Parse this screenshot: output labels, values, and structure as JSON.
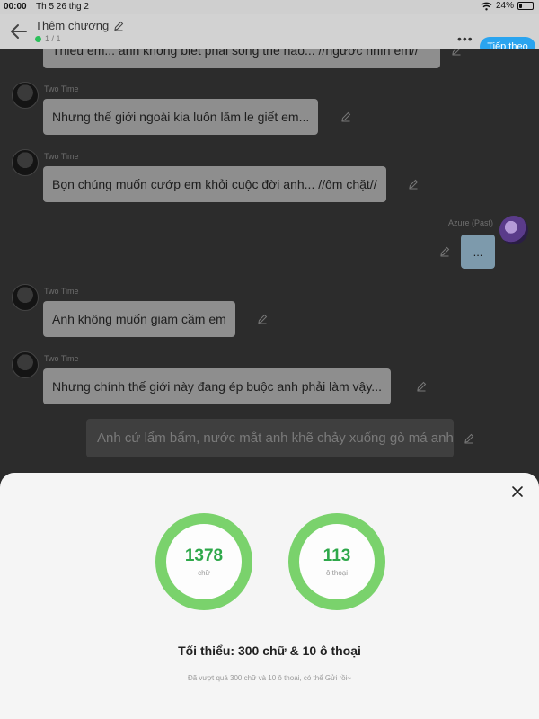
{
  "status_bar": {
    "time": "00:00",
    "date": "Th 5 26 thg 2",
    "battery": "24%",
    "battery_level": 0.24
  },
  "header": {
    "title": "Thêm chương",
    "subtitle": "1 / 1",
    "more_icon": "more-horizontal-icon",
    "next_label": "Tiếp theo",
    "next_color": "#2aa4ef"
  },
  "chat": {
    "messages": [
      {
        "sender": "",
        "text": "Thiếu em... anh không biết phải sống thế nào... //ngước nhìn em//"
      },
      {
        "sender": "Two Time",
        "text": "Nhưng thế giới ngoài kia luôn lăm le giết em..."
      },
      {
        "sender": "Two Time",
        "text": "Bọn chúng muốn cướp em khỏi cuộc đời anh... //ôm chặt//"
      },
      {
        "sender": "Azure (Past)",
        "text": "..."
      },
      {
        "sender": "Two Time",
        "text": "Anh không muốn giam cầm em"
      },
      {
        "sender": "Two Time",
        "text": "Nhưng chính thế giới này đang ép buộc anh phải làm vậy..."
      },
      {
        "sender": "",
        "text": "Anh cứ lẩm bẩm, nước mắt anh khẽ chảy xuống gò má anh"
      }
    ]
  },
  "sheet": {
    "close_icon": "close-icon",
    "word_count": "1378",
    "word_label": "chữ",
    "dialog_count": "113",
    "dialog_label": "ô thoại",
    "ring_color": "#7ad26c",
    "minimum_text": "Tối thiểu: 300 chữ & 10 ô thoại",
    "note": "Đã vượt quá 300 chữ và 10 ô thoại, có thể Gửi rồi~"
  }
}
